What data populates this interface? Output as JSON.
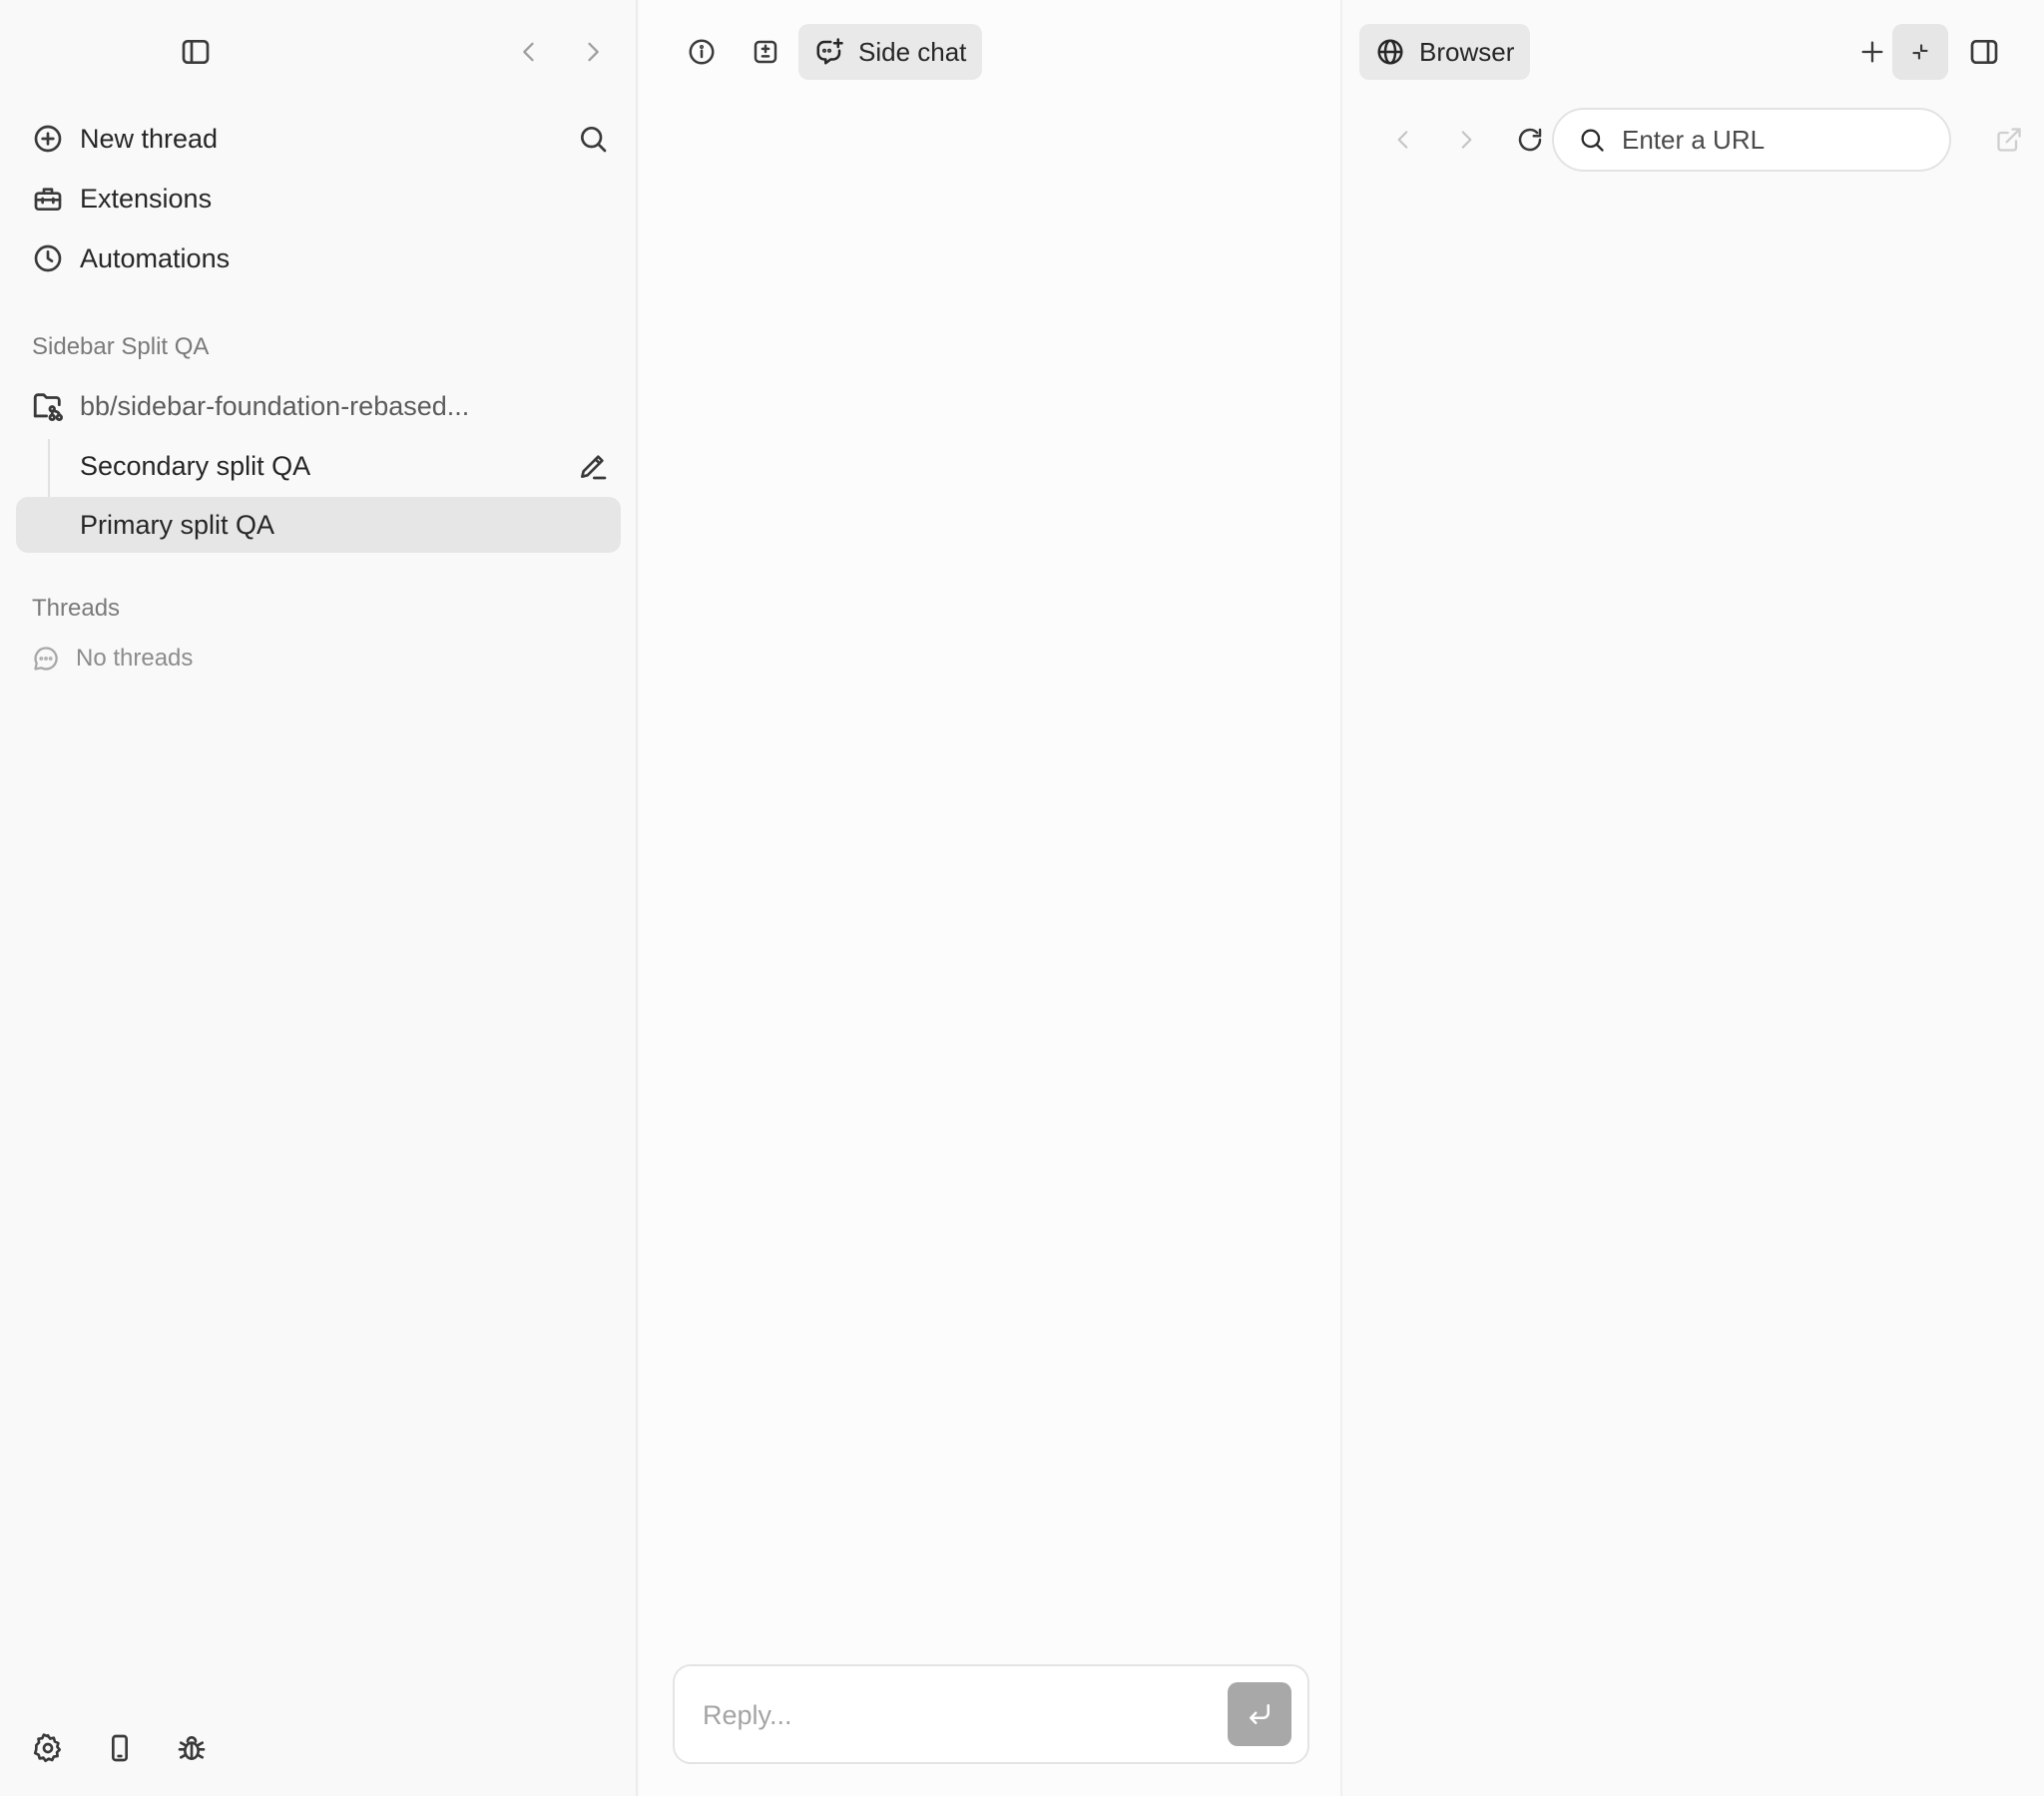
{
  "sidebar": {
    "nav": {
      "new_thread": "New thread",
      "extensions": "Extensions",
      "automations": "Automations"
    },
    "project": {
      "section_title": "Sidebar Split QA",
      "branch": "bb/sidebar-foundation-rebased...",
      "threads": [
        {
          "label": "Secondary split QA",
          "active": false
        },
        {
          "label": "Primary split QA",
          "active": true
        }
      ]
    },
    "threads_section": {
      "title": "Threads",
      "empty_text": "No threads"
    },
    "footer_icons": [
      "gear-icon",
      "phone-icon",
      "bug-icon"
    ]
  },
  "middle": {
    "tabs": {
      "side_chat": "Side chat"
    },
    "reply": {
      "placeholder": "Reply..."
    }
  },
  "browser": {
    "tab_label": "Browser",
    "url": {
      "placeholder": "Enter a URL",
      "value": ""
    }
  },
  "colors": {
    "sidebar_bg": "#f9f9f9",
    "active_row": "#e6e6e6",
    "pill_bg": "#e9e9e9",
    "send_button": "#a8a8a8"
  }
}
